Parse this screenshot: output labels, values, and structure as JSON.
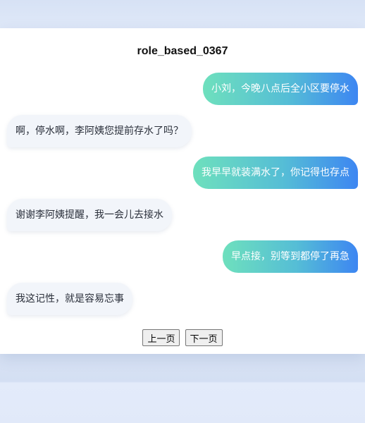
{
  "page": {
    "title": "role_based_0367"
  },
  "messages": [
    {
      "side": "out",
      "text": "小刘，今晚八点后全小区要停水"
    },
    {
      "side": "in",
      "text": "啊，停水啊，李阿姨您提前存水了吗？"
    },
    {
      "side": "out",
      "text": "我早早就装满水了，你记得也存点"
    },
    {
      "side": "in",
      "text": "谢谢李阿姨提醒，我一会儿去接水"
    },
    {
      "side": "out",
      "text": "早点接，别等到都停了再急"
    },
    {
      "side": "in",
      "text": "我这记性，就是容易忘事"
    }
  ],
  "pagination": {
    "prev_label": "上一页",
    "next_label": "下一页"
  },
  "colors": {
    "outgoing_gradient_start": "#6ee0bd",
    "outgoing_gradient_end": "#3d86f2",
    "incoming_bg": "#f2f5fa"
  }
}
